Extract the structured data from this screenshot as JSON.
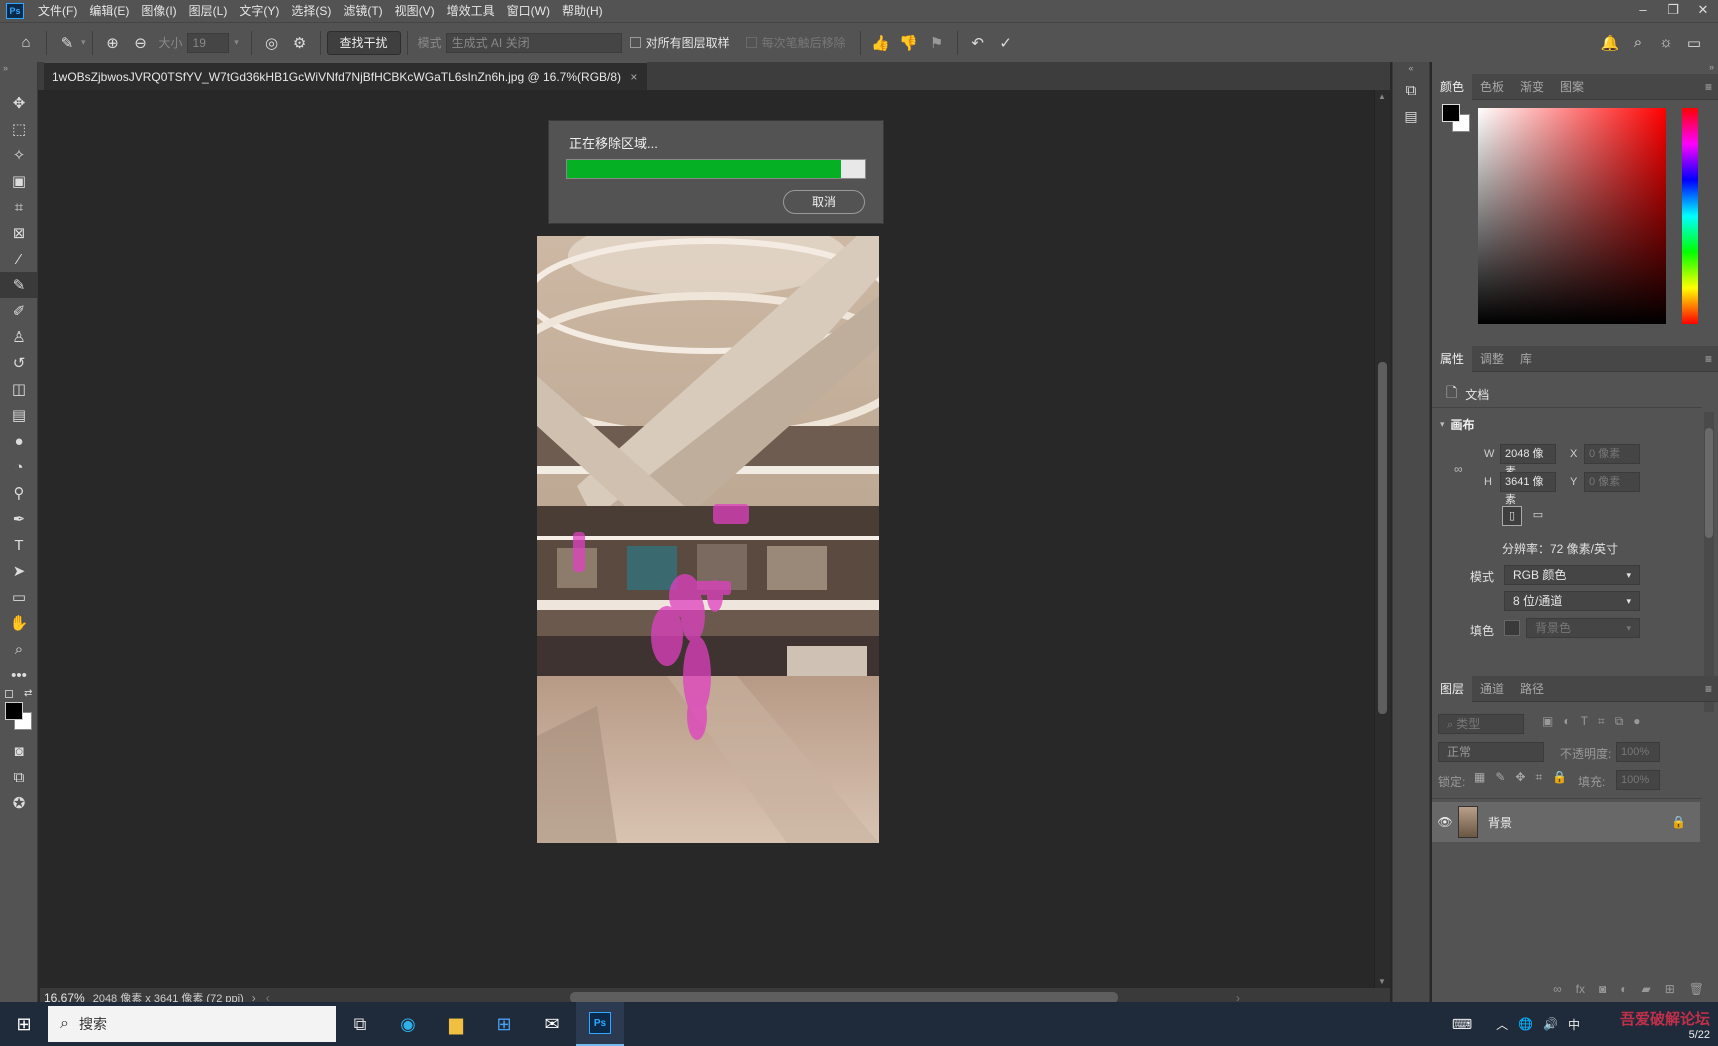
{
  "menubar": {
    "logo": "Ps",
    "items": [
      "文件(F)",
      "编辑(E)",
      "图像(I)",
      "图层(L)",
      "文字(Y)",
      "选择(S)",
      "滤镜(T)",
      "视图(V)",
      "增效工具",
      "窗口(W)",
      "帮助(H)"
    ]
  },
  "options": {
    "size_label": "大小",
    "size_value": "19",
    "find_button": "查找干扰",
    "mode_label": "模式",
    "mode_value": "生成式 AI 关闭",
    "sample_all": "对所有图层取样",
    "remove_after": "每次笔触后移除"
  },
  "document": {
    "tab_title": "1wOBsZjbwosJVRQ0TSfYV_W7tGd36kHB1GcWiVNfd7NjBfHCBKcWGaTL6sInZn6h.jpg @ 16.7%(RGB/8)",
    "tab_close": "×"
  },
  "dialog": {
    "message": "正在移除区域...",
    "progress": 0.92,
    "cancel": "取消"
  },
  "status": {
    "zoom": "16.67%",
    "info": "2048 像素 x 3641 像素 (72 ppi)"
  },
  "color_panel": {
    "tabs": [
      "颜色",
      "色板",
      "渐变",
      "图案"
    ]
  },
  "properties": {
    "tabs": [
      "属性",
      "调整",
      "库"
    ],
    "doc_label": "文档",
    "canvas_label": "画布",
    "w_label": "W",
    "w_value": "2048 像素",
    "h_label": "H",
    "h_value": "3641 像素",
    "x_label": "X",
    "x_value": "0 像素",
    "y_label": "Y",
    "y_value": "0 像素",
    "resolution": "分辨率：72 像素/英寸",
    "mode_label": "模式",
    "mode_value": "RGB 颜色",
    "depth_value": "8 位/通道",
    "fill_label": "填色",
    "fill_value": "背景色"
  },
  "layers": {
    "tabs": [
      "图层",
      "通道",
      "路径"
    ],
    "kind_placeholder": "类型",
    "blend": "正常",
    "opacity_label": "不透明度:",
    "opacity_value": "100%",
    "lock_label": "锁定:",
    "fill_label": "填充:",
    "fill_value": "100%",
    "layer_name": "背景"
  },
  "taskbar": {
    "search": "搜索",
    "ime": "中",
    "clock": "5/22",
    "watermark": "吾爱破解论坛"
  },
  "colors": {
    "progress_fill": "#06b025",
    "ps_blue": "#31a8ff",
    "highlight_magenta": "#e040c0"
  }
}
